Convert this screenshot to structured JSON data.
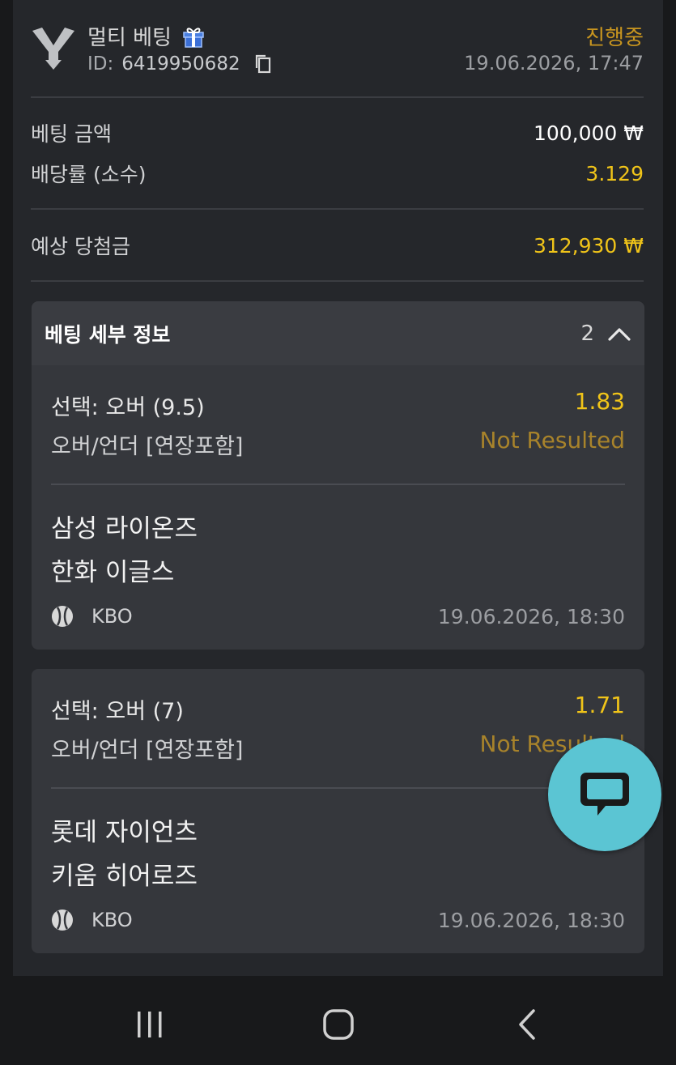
{
  "header": {
    "bet_type": "멀티 베팅",
    "id_label": "ID:",
    "id_value": "6419950682",
    "status": "진행중",
    "datetime": "19.06.2026, 17:47"
  },
  "summary": {
    "stake_label": "베팅 금액",
    "stake_value": "100,000 ₩",
    "odds_label": "배당률 (소수)",
    "odds_value": "3.129",
    "payout_label": "예상 당첨금",
    "payout_value": "312,930 ₩"
  },
  "details": {
    "title": "베팅 세부 정보",
    "count": "2",
    "selections": [
      {
        "pick": "선택: 오버 (9.5)",
        "odds": "1.83",
        "market": "오버/언더 [연장포함]",
        "result": "Not Resulted",
        "team1": "삼성 라이온즈",
        "team2": "한화 이글스",
        "league": "KBO",
        "start": "19.06.2026, 18:30"
      },
      {
        "pick": "선택: 오버 (7)",
        "odds": "1.71",
        "market": "오버/언더 [연장포함]",
        "result": "Not Resulted",
        "team1": "롯데 자이언츠",
        "team2": "키움 히어로즈",
        "league": "KBO",
        "start": "19.06.2026, 18:30"
      }
    ]
  },
  "colors": {
    "background": "#25272b",
    "accent_gold": "#f0c419",
    "status_gold": "#c8951f",
    "chat_button": "#5bc5d3"
  },
  "icons": [
    "logo-icon",
    "gift-icon",
    "copy-icon",
    "chevron-up-icon",
    "baseball-icon",
    "chat-icon",
    "recent-apps-icon",
    "home-icon",
    "back-icon"
  ]
}
